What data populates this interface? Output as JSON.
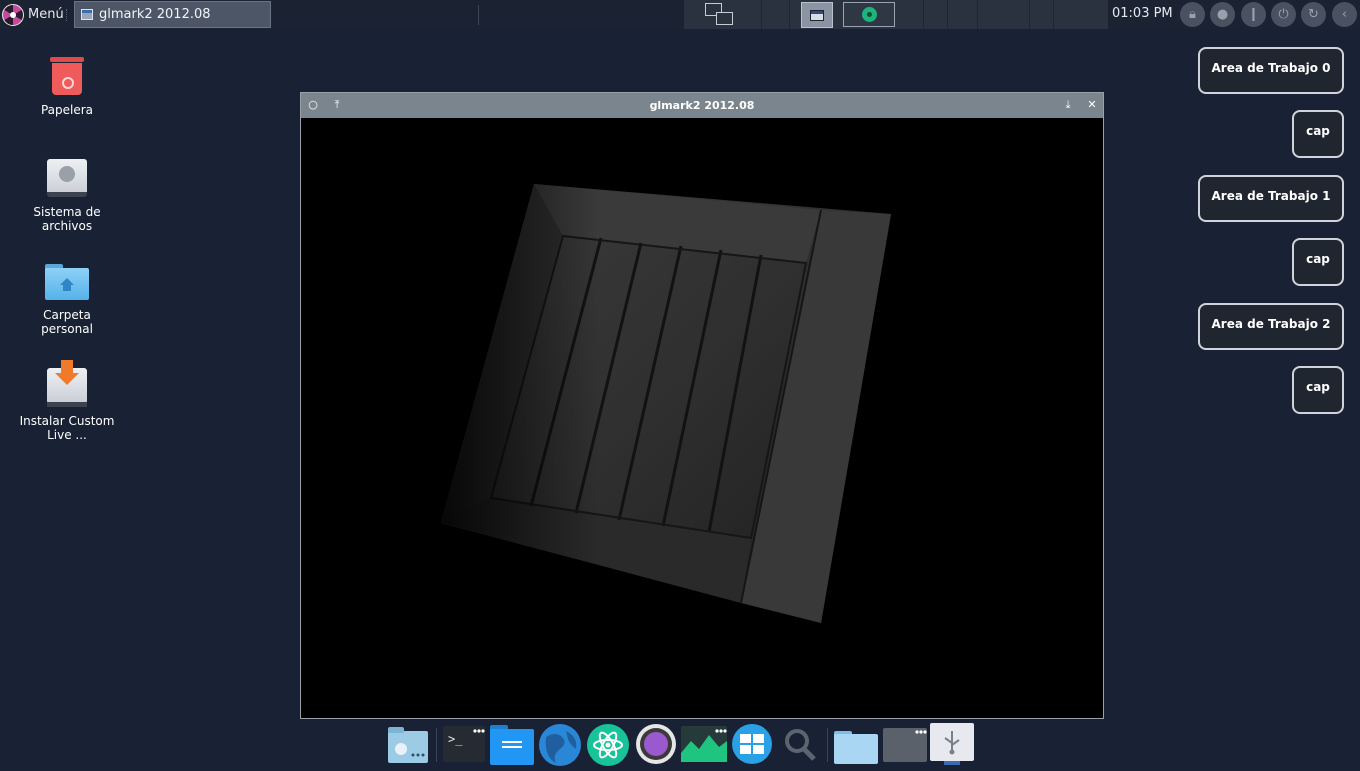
{
  "top_panel": {
    "menu_label": "Menú",
    "taskbar_window": "glmark2 2012.08",
    "clock": "01:03 PM",
    "system_buttons": [
      "lock-icon",
      "user-icon",
      "info-icon",
      "power-icon",
      "refresh-icon",
      "back-icon"
    ]
  },
  "desktop_icons": [
    {
      "label": "Papelera",
      "icon": "trash-icon"
    },
    {
      "label": "Sistema de archivos",
      "icon": "drive-icon"
    },
    {
      "label": "Carpeta personal",
      "icon": "home-folder-icon"
    },
    {
      "label": "Instalar Custom Live ...",
      "icon": "installer-icon"
    }
  ],
  "window": {
    "title": "glmark2 2012.08",
    "left_buttons": [
      "○",
      "⤒"
    ],
    "right_buttons": [
      "⤓",
      "✕"
    ]
  },
  "workspaces": [
    {
      "label": "Area de Trabajo 0"
    },
    {
      "label": "cap"
    },
    {
      "label": "Area de Trabajo 1"
    },
    {
      "label": "cap"
    },
    {
      "label": "Area de Trabajo 2"
    },
    {
      "label": "cap"
    }
  ],
  "dock": [
    "file-manager-icon",
    "terminal-icon",
    "files-icon",
    "browser-icon",
    "atom-icon",
    "screen-recorder-icon",
    "system-monitor-icon",
    "workspace-switcher-icon",
    "search-icon",
    "folder-icon",
    "window-list-icon",
    "usb-icon"
  ],
  "colors": {
    "desktop_bg": "#182234",
    "panel_bg": "#1b2332",
    "titlebar": "#7b858e",
    "accent_green": "#1eb37c",
    "trash_red": "#ef5a5a",
    "folder_blue": "#55b2ea"
  }
}
